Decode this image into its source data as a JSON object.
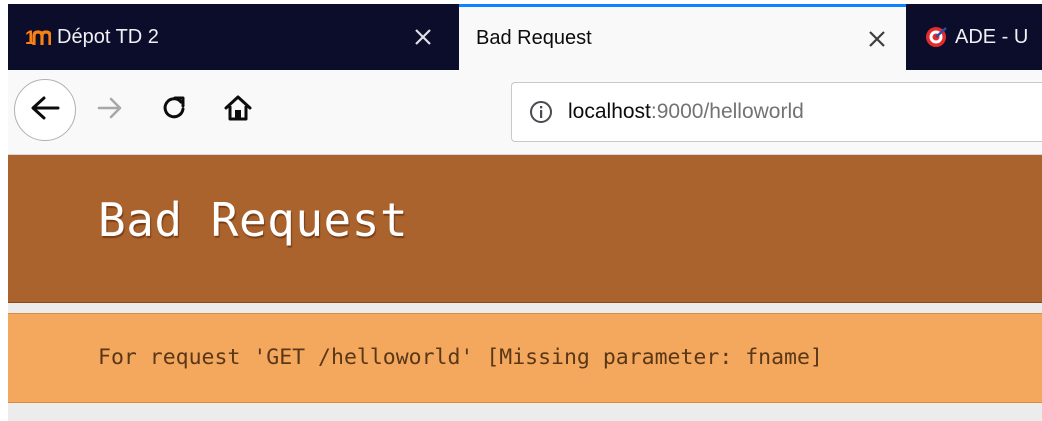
{
  "browser": {
    "tabs": [
      {
        "title": "Dépot TD 2",
        "favicon": "moodle-icon",
        "active": false
      },
      {
        "title": "Bad Request",
        "favicon": "none",
        "active": true
      },
      {
        "title": "ADE - U",
        "favicon": "ade-icon",
        "active": false
      }
    ],
    "url": {
      "host": "localhost",
      "rest": ":9000/helloworld"
    }
  },
  "page": {
    "title": "Bad Request",
    "error_message": "For request 'GET /helloworld' [Missing parameter: fname]"
  },
  "colors": {
    "tabstrip": "#0c0c2b",
    "active_tab_accent": "#0a84ff",
    "header_bg": "#ab632d",
    "error_bg": "#f4a85e",
    "error_text": "#5a3717"
  }
}
